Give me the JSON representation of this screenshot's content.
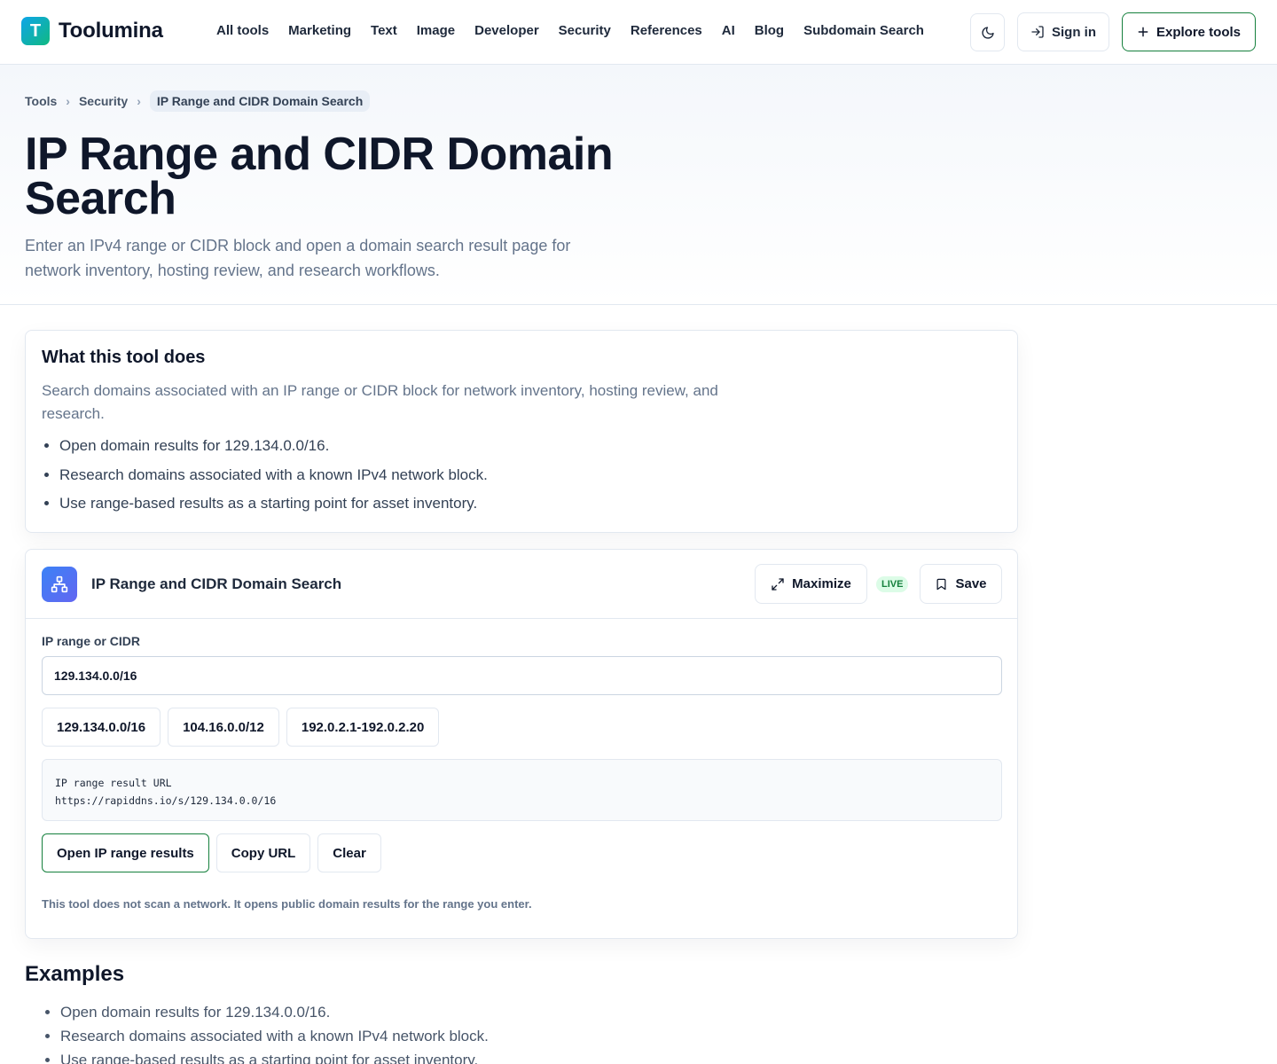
{
  "header": {
    "logo_letter": "T",
    "brand": "Toolumina",
    "nav": [
      "All tools",
      "Marketing",
      "Text",
      "Image",
      "Developer",
      "Security",
      "References",
      "AI",
      "Blog",
      "Subdomain Search"
    ],
    "theme_icon": "moon-icon",
    "signin_label": "Sign in",
    "explore_label": "Explore tools"
  },
  "breadcrumb": [
    "Tools",
    "Security",
    "IP Range and CIDR Domain Search"
  ],
  "hero": {
    "title": "IP Range and CIDR Domain Search",
    "subtitle": "Enter an IPv4 range or CIDR block and open a domain search result page for network inventory, hosting review, and research workflows."
  },
  "what": {
    "heading": "What this tool does",
    "description": "Search domains associated with an IP range or CIDR block for network inventory, hosting review, and research.",
    "bullets": [
      "Open domain results for 129.134.0.0/16.",
      "Research domains associated with a known IPv4 network block.",
      "Use range-based results as a starting point for asset inventory."
    ]
  },
  "tool": {
    "title": "IP Range and CIDR Domain Search",
    "maximize_label": "Maximize",
    "live_badge": "LIVE",
    "save_label": "Save",
    "field_label": "IP range or CIDR",
    "input_value": "129.134.0.0/16",
    "presets": [
      "129.134.0.0/16",
      "104.16.0.0/12",
      "192.0.2.1-192.0.2.20"
    ],
    "url_label": "IP range result URL",
    "url_value": "https://rapiddns.io/s/129.134.0.0/16",
    "open_label": "Open IP range results",
    "copy_label": "Copy URL",
    "clear_label": "Clear",
    "note": "This tool does not scan a network. It opens public domain results for the range you enter."
  },
  "examples": {
    "heading": "Examples",
    "items": [
      "Open domain results for 129.134.0.0/16.",
      "Research domains associated with a known IPv4 network block.",
      "Use range-based results as a starting point for asset inventory."
    ]
  },
  "colors": {
    "accent_green": "#15803d",
    "brand_gradient_start": "#0ea5e9",
    "brand_gradient_end": "#10b981",
    "tool_icon_start": "#3b82f6",
    "tool_icon_end": "#6366f1"
  }
}
